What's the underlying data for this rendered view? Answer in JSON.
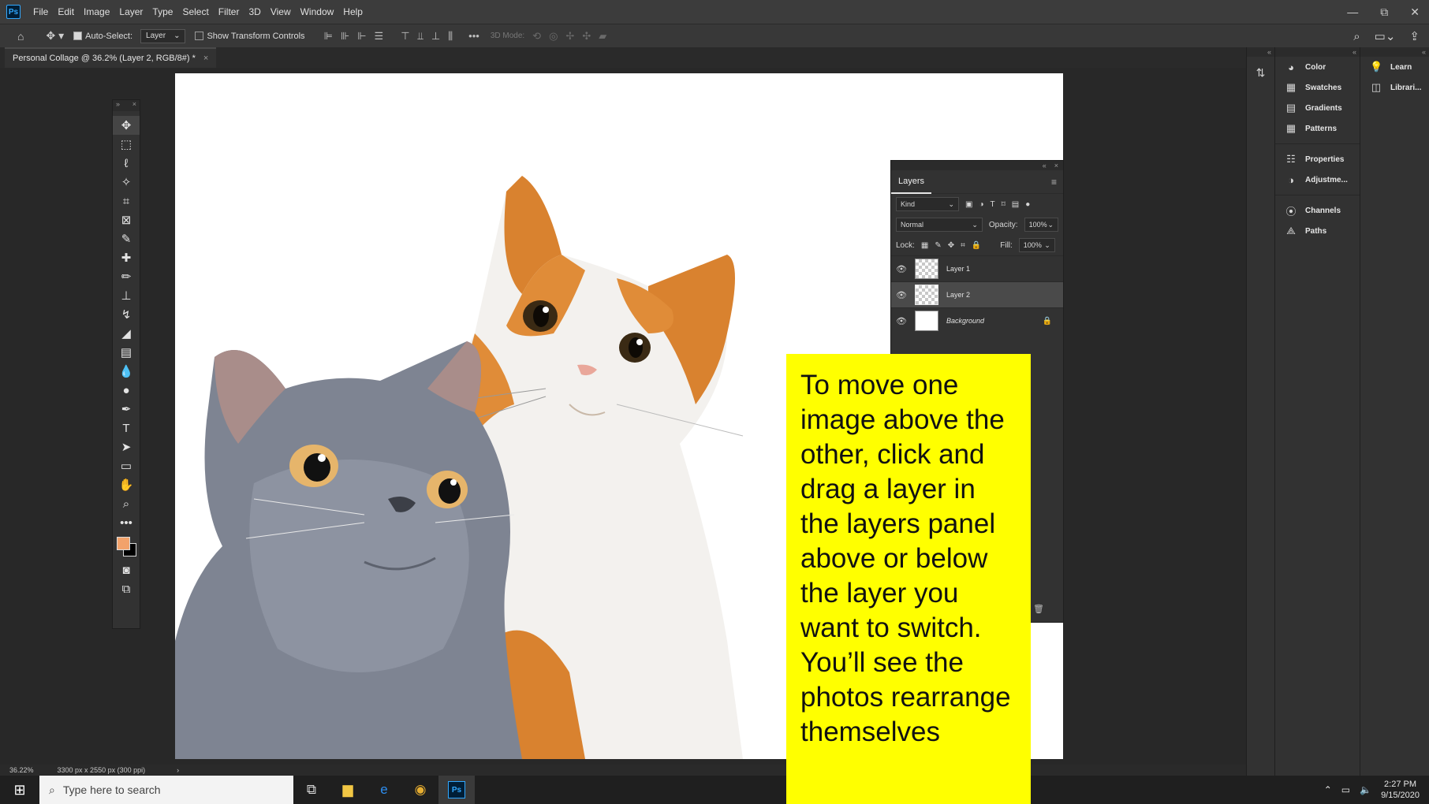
{
  "app": {
    "logo": "Ps"
  },
  "menu": [
    "File",
    "Edit",
    "Image",
    "Layer",
    "Type",
    "Select",
    "Filter",
    "3D",
    "View",
    "Window",
    "Help"
  ],
  "window_controls": [
    "—",
    "⧉",
    "✕"
  ],
  "options": {
    "auto_select_label": "Auto-Select:",
    "auto_select_target": "Layer",
    "show_transform_label": "Show Transform Controls",
    "mode_3d_label": "3D Mode:"
  },
  "document": {
    "tab_title": "Personal Collage @ 36.2% (Layer 2, RGB/8#) *"
  },
  "layers_panel": {
    "tab": "Layers",
    "kind_label": "Kind",
    "blend_mode": "Normal",
    "opacity_label": "Opacity:",
    "opacity_value": "100%",
    "lock_label": "Lock:",
    "fill_label": "Fill:",
    "fill_value": "100%",
    "layers": [
      {
        "name": "Layer 1",
        "selected": false
      },
      {
        "name": "Layer 2",
        "selected": true
      },
      {
        "name": "Background",
        "selected": false,
        "locked": true
      }
    ]
  },
  "callout": {
    "text": "To move one image above the other, click and drag a layer in the layers panel above or below the layer you want to switch. You’ll see the photos rearrange themselves"
  },
  "status": {
    "zoom": "36.22%",
    "doc_info": "3300 px x 2550 px (300 ppi)"
  },
  "dock_b": {
    "items": [
      "Color",
      "Swatches",
      "Gradients",
      "Patterns",
      "Properties",
      "Adjustme...",
      "Channels",
      "Paths"
    ]
  },
  "dock_c": {
    "items": [
      "Learn",
      "Librari..."
    ]
  },
  "taskbar": {
    "search_placeholder": "Type here to search",
    "time": "2:27 PM",
    "date": "9/15/2020"
  },
  "colors": {
    "foreground": "#f2a26b",
    "background": "#000000",
    "callout": "#ffff00"
  }
}
